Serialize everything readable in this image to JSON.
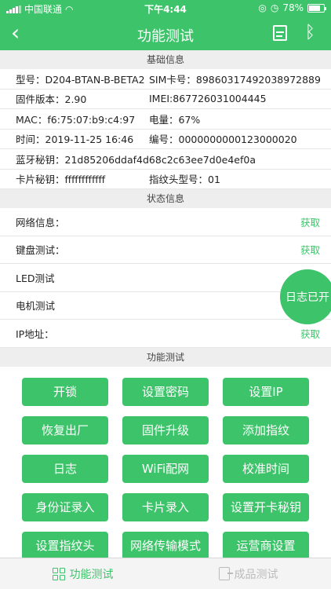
{
  "status_bar": {
    "carrier": "中国联通",
    "time": "下午4:44",
    "battery": "78%",
    "battery_level": 0.78
  },
  "nav": {
    "back_glyph": "‹",
    "title": "功能测试",
    "bluetooth_glyph": "ᛒ"
  },
  "sections": {
    "basic": "基础信息",
    "status": "状态信息",
    "function": "功能测试"
  },
  "basic_info": {
    "r1a": "型号：D204-BTAN-B-BETA2",
    "r1b": "SIM卡号：89860317492038972889",
    "r2a": "固件版本：2.90",
    "r2b": "IMEI:867726031004445",
    "r3a": "MAC：f6:75:07:b9:c4:97",
    "r3b": "电量：67%",
    "r4a": "时间：2019-11-25 16:46",
    "r4b": "编号：0000000000123000020",
    "r5": "蓝牙秘钥：21d85206ddaf4d68c2c63ee7d0e4ef0a",
    "r6a": "卡片秘钥：ffffffffffff",
    "r6b": "指纹头型号：01"
  },
  "status_info": [
    {
      "label": "网络信息：",
      "action": "获取"
    },
    {
      "label": "键盘测试：",
      "action": "获取"
    },
    {
      "label": "LED测试",
      "action": ""
    },
    {
      "label": "电机测试",
      "action": ""
    },
    {
      "label": "IP地址：",
      "action": "获取"
    }
  ],
  "buttons": [
    "开锁",
    "设置密码",
    "设置IP",
    "恢复出厂",
    "固件升级",
    "添加指纹",
    "日志",
    "WiFi配网",
    "校准时间",
    "身份证录入",
    "卡片录入",
    "设置开卡秘钥",
    "设置指纹头",
    "网络传输模式",
    "运营商设置"
  ],
  "float_button": "日志已开",
  "tabs": {
    "function_test": "功能测试",
    "product_test": "成品测试"
  },
  "colors": {
    "accent": "#3dc46a",
    "section_bg": "#eeeeee"
  }
}
